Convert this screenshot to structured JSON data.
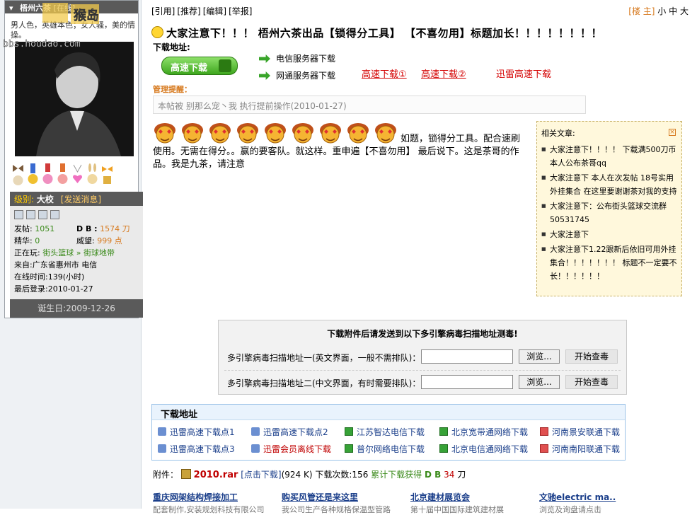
{
  "profile": {
    "username": "梧州六茶",
    "tag": "[在线]",
    "watermark": "bbs.houdao.com",
    "watermark_brand": "猴岛",
    "signature": "男人色，英雄本色；女人骚，美的情操。",
    "level_label": "级别:",
    "level": "大校",
    "pm_link": "[发送消息]",
    "stats": {
      "posts_label": "发帖:",
      "posts": "1051",
      "db_label": "D B :",
      "db": "1574 刀",
      "elite_label": "精华:",
      "elite": "0",
      "prestige_label": "威望:",
      "prestige": "999 点",
      "playing_label": "正在玩:",
      "playing_game": "街头篮球",
      "playing_sep": " » ",
      "playing_area": "街球地带",
      "from_label": "来自:",
      "from": "广东省惠州市 电信",
      "online_label": "在线时间:",
      "online": "139(小时)",
      "last_label": "最后登录:",
      "last": "2010-01-27"
    },
    "birthday": "诞生日:2009-12-26"
  },
  "toolbar": {
    "quote": "[引用]",
    "recommend": "[推荐]",
    "edit": "[编辑]",
    "report": "[举报]",
    "floor": "[楼 主]",
    "font_small": "小",
    "font_mid": "中",
    "font_large": "大"
  },
  "post": {
    "title": "大家注意下！！！ 梧州六茶出品【锁得分工具】 【不喜勿用】标题加长！！！！！！！！",
    "download_label": "下载地址:",
    "big_download_btn": "高速下载",
    "telecom_server": "电信服务器下载",
    "netcom_server": "网通服务器下载",
    "fast1": "高速下载①",
    "fast2": "高速下载②",
    "xunlei": "迅雷高速下载",
    "mgmt_label": "管理提醒：",
    "mgmt_notice": "本帖被 别那么宠丶我 执行提前操作(2010-01-27)",
    "body_line1": "如题，锁得分工具。配合速刷",
    "body_rest": "使用。无需在得分。。赢的要客队。就这样。重申遍【不喜勿用】 最后说下。这是茶哥的作品。我是九茶，请注意"
  },
  "related": {
    "heading": "相关文章:",
    "close": "×",
    "items": [
      "大家注意下！！！！ 下载满500刀币本人公布茶哥qq",
      "大家注意下 本人在次发帖 18号实用外挂集合 在这里要谢谢茶对我的支持",
      "大家注意下：公布街头篮球交流群50531745",
      "大家注意下",
      "大家注意下1.22跟新后依旧可用外挂集合！！！！！！！ 标题不一定要不长！！！！！！"
    ]
  },
  "scan": {
    "heading": "下载附件后请发送到以下多引擎病毒扫描地址测毒!",
    "row1_label": "多引擎病毒扫描地址一(英文界面，一般不需排队)：",
    "row2_label": "多引擎病毒扫描地址二(中文界面，有时需要排队)：",
    "browse": "浏览...",
    "start": "开始查毒"
  },
  "downloads": {
    "heading": "下载地址",
    "items": [
      {
        "text": "迅雷高速下载点1",
        "color": "blue",
        "icon": "xunlei-icon"
      },
      {
        "text": "迅雷高速下载点2",
        "color": "blue",
        "icon": "xunlei-icon"
      },
      {
        "text": "江苏智达电信下载",
        "color": "blue",
        "icon": "green-download-icon"
      },
      {
        "text": "北京宽带通网络下载",
        "color": "blue",
        "icon": "green-download-icon"
      },
      {
        "text": "河南景安联通下载",
        "color": "blue",
        "icon": "red-download-icon"
      },
      {
        "text": "迅雷高速下载点3",
        "color": "blue",
        "icon": "xunlei-icon"
      },
      {
        "text": "迅雷会员离线下载",
        "color": "red",
        "icon": "xunlei-icon"
      },
      {
        "text": "普尔网络电信下载",
        "color": "blue",
        "icon": "green-download-icon"
      },
      {
        "text": "北京电信通网络下载",
        "color": "blue",
        "icon": "green-download-icon"
      },
      {
        "text": "河南南阳联通下载",
        "color": "blue",
        "icon": "red-download-icon"
      }
    ]
  },
  "attachment": {
    "label": "附件：",
    "filename": "2010.rar",
    "click": "[点击下载]",
    "size": "(924 K)",
    "count_label": "下载次数:",
    "count": "156",
    "gain": "累计下载获得",
    "db": "D B",
    "amount": "34",
    "unit": "刀"
  },
  "ads": [
    {
      "title": "重庆网架结构焊接加工",
      "sub": "配套制作,安装规划科技有限公司"
    },
    {
      "title": "购买风管还是来这里",
      "sub": "我公司生产各种规格保温型管路"
    },
    {
      "title": "北京建材展览会",
      "sub": "第十届中国国际建筑建材展"
    },
    {
      "title": "文驰electric ma..",
      "sub": "浏览及询盘请点击"
    }
  ],
  "colors": {
    "accent_orange": "#d77a1f",
    "link_red": "#d40000",
    "green_stat": "#3a8a1a",
    "dark_bar": "#5a5a5a"
  }
}
